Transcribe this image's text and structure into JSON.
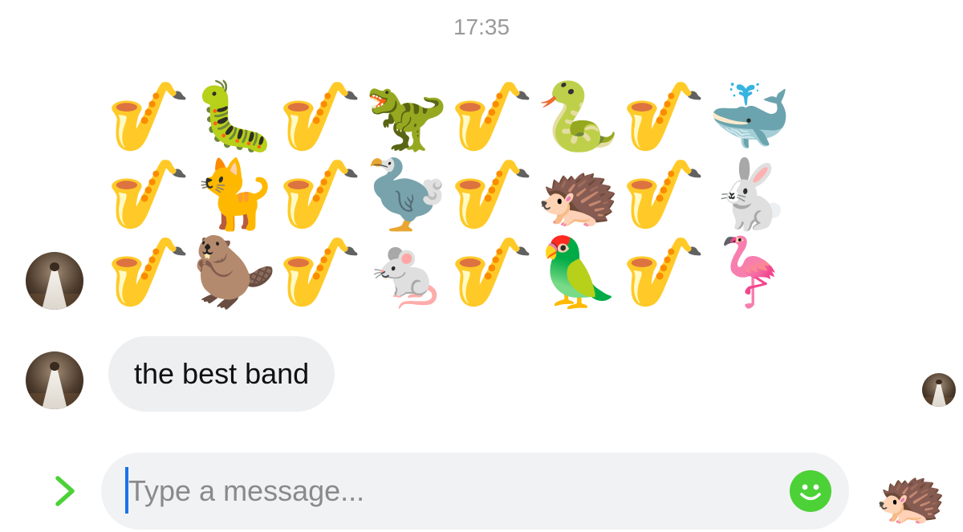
{
  "conversation": {
    "timestamp": "17:35",
    "emoji_message": {
      "rows": [
        [
          "🎷",
          "🐛",
          "🎷",
          "🦖",
          "🎷",
          "🐍",
          "🎷",
          "🐳"
        ],
        [
          "🎷",
          "🐈",
          "🎷",
          "🦤",
          "🎷",
          "🦔",
          "🎷",
          "🐇"
        ],
        [
          "🎷",
          "🦫",
          "🎷",
          "🐁",
          "🎷",
          "🦜",
          "🎷",
          "🦩"
        ]
      ],
      "icon_names": [
        [
          "saxophone",
          "caterpillar",
          "saxophone",
          "t-rex",
          "saxophone",
          "snake",
          "saxophone",
          "whale"
        ],
        [
          "saxophone",
          "cat",
          "saxophone",
          "dodo",
          "saxophone",
          "hedgehog",
          "saxophone",
          "rabbit"
        ],
        [
          "saxophone",
          "beaver",
          "saxophone",
          "mouse",
          "saxophone",
          "parrot",
          "saxophone",
          "flamingo"
        ]
      ]
    },
    "text_message": "the best band"
  },
  "composer": {
    "placeholder": "Type a message...",
    "value": "",
    "expand_icon": "chevron-right-icon",
    "emoji_icon": "smiley-face-icon",
    "sticker": "🦔"
  },
  "colors": {
    "accent": "#4cd137",
    "caret": "#1a73e8",
    "bubble": "#eeeff1",
    "composer_bg": "#f1f2f4",
    "timestamp": "#9a9a9a"
  }
}
